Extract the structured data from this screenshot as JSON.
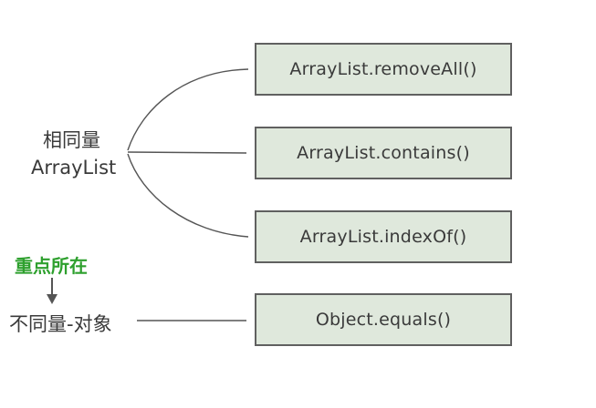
{
  "left_labels": {
    "same_type_line1": "相同量",
    "same_type_line2": "ArrayList",
    "focus": "重点所在",
    "different_type": "不同量-对象"
  },
  "methods": [
    "ArrayList.removeAll()",
    "ArrayList.contains()",
    "ArrayList.indexOf()",
    "Object.equals()"
  ],
  "colors": {
    "box_fill": "#dfe8dc",
    "box_border": "#606060",
    "text": "#3a3a3a",
    "focus_text": "#2ea02e",
    "line": "#555555"
  }
}
